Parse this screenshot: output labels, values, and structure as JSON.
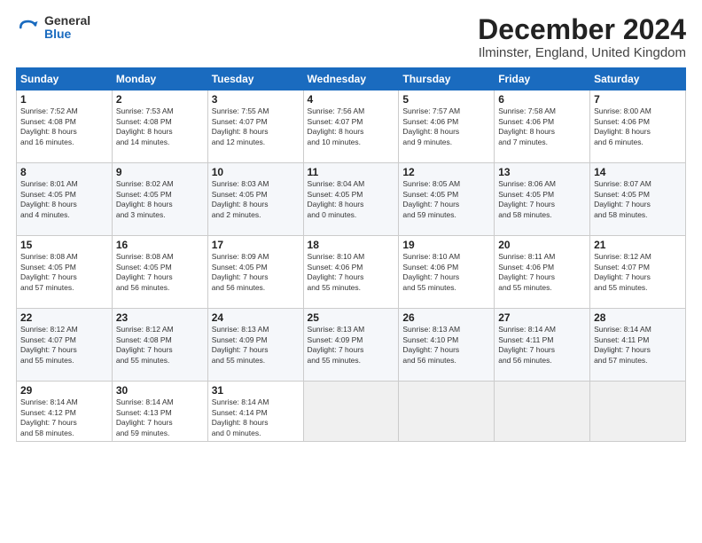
{
  "header": {
    "logo_general": "General",
    "logo_blue": "Blue",
    "title": "December 2024",
    "subtitle": "Ilminster, England, United Kingdom"
  },
  "weekdays": [
    "Sunday",
    "Monday",
    "Tuesday",
    "Wednesday",
    "Thursday",
    "Friday",
    "Saturday"
  ],
  "weeks": [
    [
      {
        "day": "1",
        "lines": [
          "Sunrise: 7:52 AM",
          "Sunset: 4:08 PM",
          "Daylight: 8 hours",
          "and 16 minutes."
        ]
      },
      {
        "day": "2",
        "lines": [
          "Sunrise: 7:53 AM",
          "Sunset: 4:08 PM",
          "Daylight: 8 hours",
          "and 14 minutes."
        ]
      },
      {
        "day": "3",
        "lines": [
          "Sunrise: 7:55 AM",
          "Sunset: 4:07 PM",
          "Daylight: 8 hours",
          "and 12 minutes."
        ]
      },
      {
        "day": "4",
        "lines": [
          "Sunrise: 7:56 AM",
          "Sunset: 4:07 PM",
          "Daylight: 8 hours",
          "and 10 minutes."
        ]
      },
      {
        "day": "5",
        "lines": [
          "Sunrise: 7:57 AM",
          "Sunset: 4:06 PM",
          "Daylight: 8 hours",
          "and 9 minutes."
        ]
      },
      {
        "day": "6",
        "lines": [
          "Sunrise: 7:58 AM",
          "Sunset: 4:06 PM",
          "Daylight: 8 hours",
          "and 7 minutes."
        ]
      },
      {
        "day": "7",
        "lines": [
          "Sunrise: 8:00 AM",
          "Sunset: 4:06 PM",
          "Daylight: 8 hours",
          "and 6 minutes."
        ]
      }
    ],
    [
      {
        "day": "8",
        "lines": [
          "Sunrise: 8:01 AM",
          "Sunset: 4:05 PM",
          "Daylight: 8 hours",
          "and 4 minutes."
        ]
      },
      {
        "day": "9",
        "lines": [
          "Sunrise: 8:02 AM",
          "Sunset: 4:05 PM",
          "Daylight: 8 hours",
          "and 3 minutes."
        ]
      },
      {
        "day": "10",
        "lines": [
          "Sunrise: 8:03 AM",
          "Sunset: 4:05 PM",
          "Daylight: 8 hours",
          "and 2 minutes."
        ]
      },
      {
        "day": "11",
        "lines": [
          "Sunrise: 8:04 AM",
          "Sunset: 4:05 PM",
          "Daylight: 8 hours",
          "and 0 minutes."
        ]
      },
      {
        "day": "12",
        "lines": [
          "Sunrise: 8:05 AM",
          "Sunset: 4:05 PM",
          "Daylight: 7 hours",
          "and 59 minutes."
        ]
      },
      {
        "day": "13",
        "lines": [
          "Sunrise: 8:06 AM",
          "Sunset: 4:05 PM",
          "Daylight: 7 hours",
          "and 58 minutes."
        ]
      },
      {
        "day": "14",
        "lines": [
          "Sunrise: 8:07 AM",
          "Sunset: 4:05 PM",
          "Daylight: 7 hours",
          "and 58 minutes."
        ]
      }
    ],
    [
      {
        "day": "15",
        "lines": [
          "Sunrise: 8:08 AM",
          "Sunset: 4:05 PM",
          "Daylight: 7 hours",
          "and 57 minutes."
        ]
      },
      {
        "day": "16",
        "lines": [
          "Sunrise: 8:08 AM",
          "Sunset: 4:05 PM",
          "Daylight: 7 hours",
          "and 56 minutes."
        ]
      },
      {
        "day": "17",
        "lines": [
          "Sunrise: 8:09 AM",
          "Sunset: 4:05 PM",
          "Daylight: 7 hours",
          "and 56 minutes."
        ]
      },
      {
        "day": "18",
        "lines": [
          "Sunrise: 8:10 AM",
          "Sunset: 4:06 PM",
          "Daylight: 7 hours",
          "and 55 minutes."
        ]
      },
      {
        "day": "19",
        "lines": [
          "Sunrise: 8:10 AM",
          "Sunset: 4:06 PM",
          "Daylight: 7 hours",
          "and 55 minutes."
        ]
      },
      {
        "day": "20",
        "lines": [
          "Sunrise: 8:11 AM",
          "Sunset: 4:06 PM",
          "Daylight: 7 hours",
          "and 55 minutes."
        ]
      },
      {
        "day": "21",
        "lines": [
          "Sunrise: 8:12 AM",
          "Sunset: 4:07 PM",
          "Daylight: 7 hours",
          "and 55 minutes."
        ]
      }
    ],
    [
      {
        "day": "22",
        "lines": [
          "Sunrise: 8:12 AM",
          "Sunset: 4:07 PM",
          "Daylight: 7 hours",
          "and 55 minutes."
        ]
      },
      {
        "day": "23",
        "lines": [
          "Sunrise: 8:12 AM",
          "Sunset: 4:08 PM",
          "Daylight: 7 hours",
          "and 55 minutes."
        ]
      },
      {
        "day": "24",
        "lines": [
          "Sunrise: 8:13 AM",
          "Sunset: 4:09 PM",
          "Daylight: 7 hours",
          "and 55 minutes."
        ]
      },
      {
        "day": "25",
        "lines": [
          "Sunrise: 8:13 AM",
          "Sunset: 4:09 PM",
          "Daylight: 7 hours",
          "and 55 minutes."
        ]
      },
      {
        "day": "26",
        "lines": [
          "Sunrise: 8:13 AM",
          "Sunset: 4:10 PM",
          "Daylight: 7 hours",
          "and 56 minutes."
        ]
      },
      {
        "day": "27",
        "lines": [
          "Sunrise: 8:14 AM",
          "Sunset: 4:11 PM",
          "Daylight: 7 hours",
          "and 56 minutes."
        ]
      },
      {
        "day": "28",
        "lines": [
          "Sunrise: 8:14 AM",
          "Sunset: 4:11 PM",
          "Daylight: 7 hours",
          "and 57 minutes."
        ]
      }
    ],
    [
      {
        "day": "29",
        "lines": [
          "Sunrise: 8:14 AM",
          "Sunset: 4:12 PM",
          "Daylight: 7 hours",
          "and 58 minutes."
        ]
      },
      {
        "day": "30",
        "lines": [
          "Sunrise: 8:14 AM",
          "Sunset: 4:13 PM",
          "Daylight: 7 hours",
          "and 59 minutes."
        ]
      },
      {
        "day": "31",
        "lines": [
          "Sunrise: 8:14 AM",
          "Sunset: 4:14 PM",
          "Daylight: 8 hours",
          "and 0 minutes."
        ]
      },
      null,
      null,
      null,
      null
    ]
  ]
}
